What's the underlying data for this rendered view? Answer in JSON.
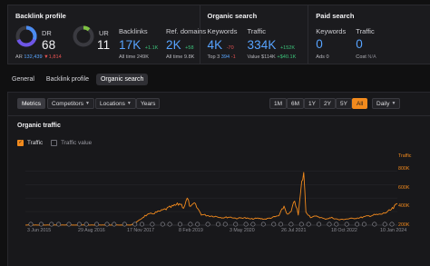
{
  "backlink_profile": {
    "title": "Backlink profile",
    "dr": {
      "label": "DR",
      "value": "68",
      "ring_fraction": 0.68,
      "ar_label": "AR",
      "ar_value": "132,439",
      "ar_delta": "▼1,814"
    },
    "ur": {
      "label": "UR",
      "value": "11",
      "ring_fraction": 0.11
    },
    "backlinks": {
      "label": "Backlinks",
      "value": "17K",
      "delta": "+1.1K",
      "sub_label": "All time",
      "sub_value": "249K"
    },
    "ref_domains": {
      "label": "Ref. domains",
      "value": "2K",
      "delta": "+58",
      "sub_label": "All time",
      "sub_value": "9.8K"
    }
  },
  "organic_search": {
    "title": "Organic search",
    "keywords": {
      "label": "Keywords",
      "value": "4K",
      "delta": "-70",
      "sub_label": "Top 3",
      "sub_value": "394",
      "sub_delta": "-1"
    },
    "traffic": {
      "label": "Traffic",
      "value": "334K",
      "delta": "+152K",
      "sub_label": "Value",
      "sub_value": "$114K",
      "sub_delta": "+$40.1K"
    }
  },
  "paid_search": {
    "title": "Paid search",
    "keywords": {
      "label": "Keywords",
      "value": "0",
      "sub_label": "Ads",
      "sub_value": "0"
    },
    "traffic": {
      "label": "Traffic",
      "value": "0",
      "sub_label": "Cost",
      "sub_value": "N/A"
    }
  },
  "tabs": [
    "General",
    "Backlink profile",
    "Organic search"
  ],
  "active_tab": "Organic search",
  "toolbar": {
    "metrics": "Metrics",
    "competitors": "Competitors",
    "locations": "Locations",
    "years": "Years",
    "ranges": [
      "1M",
      "6M",
      "1Y",
      "2Y",
      "5Y",
      "All"
    ],
    "active_range": "All",
    "interval": "Daily"
  },
  "chart_panel": {
    "title": "Organic traffic",
    "legend": [
      {
        "label": "Traffic",
        "checked": true
      },
      {
        "label": "Traffic value",
        "checked": false
      }
    ]
  },
  "colors": {
    "accent": "#f28a1d",
    "link_blue": "#57a3ff",
    "up_green": "#3cc27a",
    "down_red": "#e65252",
    "panel": "#18181b"
  },
  "chart_data": {
    "type": "line",
    "series": [
      {
        "name": "Traffic",
        "color": "#f28a1d"
      }
    ],
    "y_axis_title": "Traffic",
    "y_ticks": [
      "800K",
      "600K",
      "400K",
      "200K"
    ],
    "x_ticks": [
      "3 Jun 2015",
      "29 Aug 2016",
      "17 Nov 2017",
      "8 Feb 2019",
      "3 May 2020",
      "26 Jul 2021",
      "18 Oct 2022",
      "10 Jan 2024"
    ],
    "ylim": [
      0,
      900000
    ],
    "x_range": [
      "2015-06-03",
      "2024-03-20"
    ],
    "points": [
      [
        "2015-06-03",
        2000
      ],
      [
        "2016-06-01",
        2000
      ],
      [
        "2017-06-01",
        2000
      ],
      [
        "2017-12-01",
        2000
      ],
      [
        "2018-02-01",
        60000
      ],
      [
        "2018-04-01",
        140000
      ],
      [
        "2018-06-01",
        170000
      ],
      [
        "2018-08-01",
        200000
      ],
      [
        "2018-10-01",
        240000
      ],
      [
        "2018-12-01",
        280000
      ],
      [
        "2019-02-01",
        320000
      ],
      [
        "2019-03-01",
        260000
      ],
      [
        "2019-04-01",
        390000
      ],
      [
        "2019-05-01",
        260000
      ],
      [
        "2019-06-01",
        320000
      ],
      [
        "2019-08-01",
        160000
      ],
      [
        "2019-10-01",
        140000
      ],
      [
        "2019-12-01",
        130000
      ],
      [
        "2020-02-01",
        110000
      ],
      [
        "2020-04-01",
        120000
      ],
      [
        "2020-06-01",
        100000
      ],
      [
        "2020-08-01",
        110000
      ],
      [
        "2020-10-01",
        90000
      ],
      [
        "2020-12-01",
        100000
      ],
      [
        "2021-02-01",
        90000
      ],
      [
        "2021-04-01",
        110000
      ],
      [
        "2021-06-01",
        140000
      ],
      [
        "2021-07-15",
        280000
      ],
      [
        "2021-08-15",
        150000
      ],
      [
        "2021-09-15",
        200000
      ],
      [
        "2021-10-15",
        370000
      ],
      [
        "2021-11-15",
        150000
      ],
      [
        "2021-12-15",
        620000
      ],
      [
        "2022-01-01",
        780000
      ],
      [
        "2022-01-20",
        200000
      ],
      [
        "2022-03-01",
        120000
      ],
      [
        "2022-05-01",
        130000
      ],
      [
        "2022-07-01",
        90000
      ],
      [
        "2022-09-01",
        110000
      ],
      [
        "2022-11-01",
        80000
      ],
      [
        "2023-01-01",
        90000
      ],
      [
        "2023-03-01",
        100000
      ],
      [
        "2023-05-01",
        110000
      ],
      [
        "2023-07-01",
        130000
      ],
      [
        "2023-09-01",
        150000
      ],
      [
        "2023-11-01",
        160000
      ],
      [
        "2024-01-01",
        200000
      ],
      [
        "2024-02-15",
        250000
      ],
      [
        "2024-03-20",
        320000
      ]
    ]
  }
}
